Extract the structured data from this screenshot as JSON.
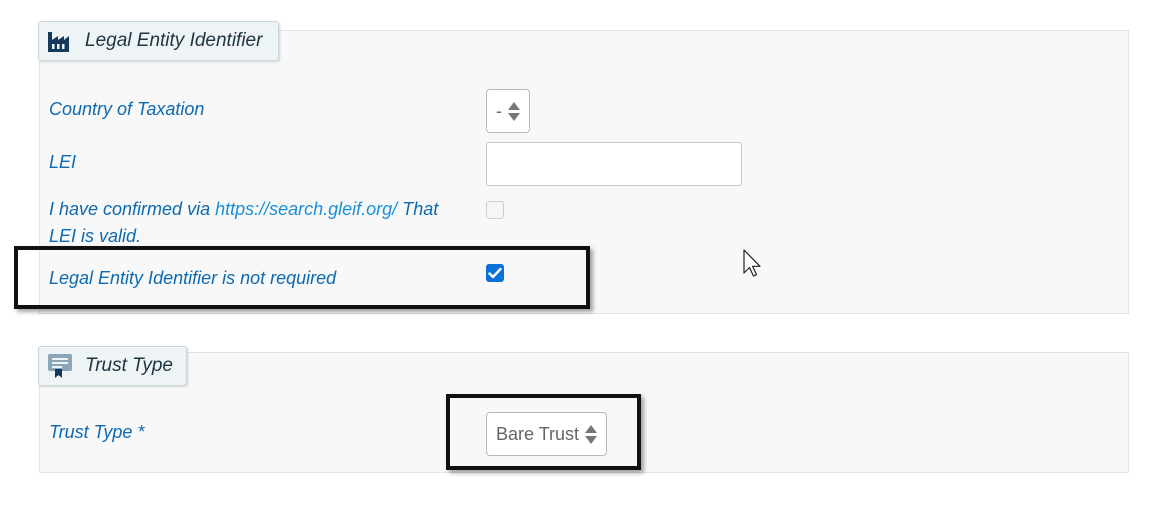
{
  "lei_section": {
    "title": "Legal Entity Identifier",
    "icon": "factory-icon",
    "country_of_taxation": {
      "label": "Country of Taxation",
      "selected": "-"
    },
    "lei": {
      "label": "LEI",
      "value": ""
    },
    "confirm": {
      "label_prefix": "I have confirmed via",
      "link_text": "https://search.gleif.org/",
      "label_suffix": "That",
      "label_line2": "LEI is valid.",
      "checked": false
    },
    "not_required": {
      "label": "Legal Entity Identifier is not required",
      "checked": true
    }
  },
  "trust_section": {
    "title": "Trust Type",
    "icon": "certificate-icon",
    "trust_type": {
      "label": "Trust Type *",
      "selected": "Bare Trust"
    }
  },
  "colors": {
    "label": "#0d6ab0",
    "link": "#1a8fd8",
    "checkbox_checked": "#0b70d7",
    "panel_bg": "#f8f8f8",
    "legend_bg": "#eef3f6"
  }
}
